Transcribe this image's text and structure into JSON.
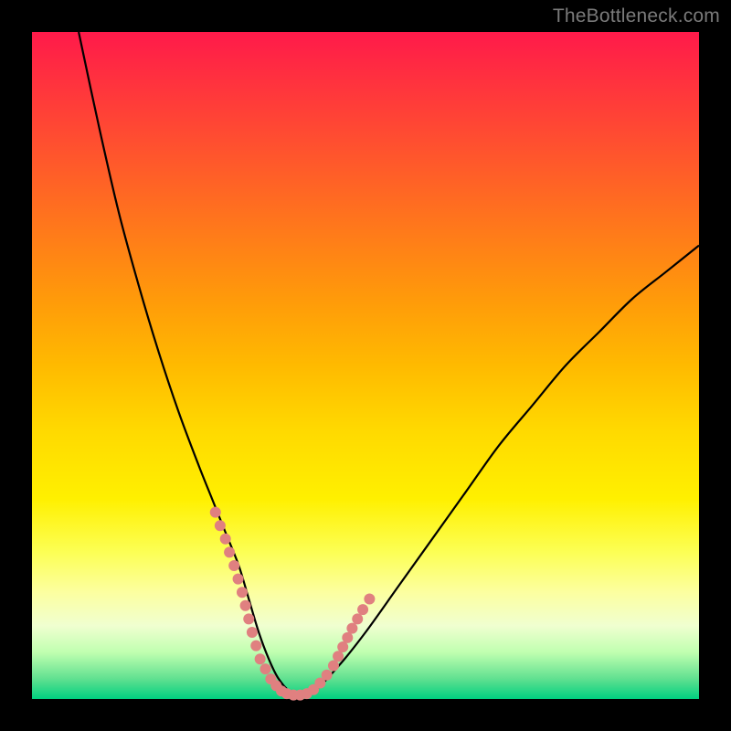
{
  "watermark": "TheBottleneck.com",
  "chart_data": {
    "type": "line",
    "title": "",
    "xlabel": "",
    "ylabel": "",
    "xlim": [
      0,
      100
    ],
    "ylim": [
      0,
      100
    ],
    "grid": false,
    "series": [
      {
        "name": "bottleneck-curve",
        "color": "#000000",
        "x": [
          7,
          10,
          13,
          16,
          19,
          22,
          25,
          27,
          29,
          31,
          32.5,
          34,
          35.5,
          37,
          39,
          42,
          46,
          50,
          55,
          60,
          65,
          70,
          75,
          80,
          85,
          90,
          95,
          100
        ],
        "y": [
          100,
          86,
          73,
          62,
          52,
          43,
          35,
          30,
          25,
          20,
          15,
          10,
          6,
          3,
          1,
          1,
          5,
          10,
          17,
          24,
          31,
          38,
          44,
          50,
          55,
          60,
          64,
          68
        ]
      }
    ],
    "markers": {
      "name": "highlight-dots",
      "color": "#e08080",
      "radius_px": 6,
      "x": [
        27.5,
        28.2,
        29.0,
        29.6,
        30.3,
        30.9,
        31.5,
        32.0,
        32.5,
        33.0,
        33.6,
        34.2,
        35.0,
        35.8,
        36.6,
        37.4,
        38.2,
        39.2,
        40.2,
        41.2,
        42.2,
        43.2,
        44.2,
        45.2,
        45.9,
        46.6,
        47.3,
        48.0,
        48.8,
        49.6,
        50.6
      ],
      "y": [
        28,
        26,
        24,
        22,
        20,
        18,
        16,
        14,
        12,
        10,
        8,
        6,
        4.5,
        3,
        2,
        1.2,
        0.8,
        0.6,
        0.6,
        0.8,
        1.4,
        2.4,
        3.6,
        5,
        6.4,
        7.8,
        9.2,
        10.6,
        12,
        13.4,
        15
      ]
    }
  }
}
